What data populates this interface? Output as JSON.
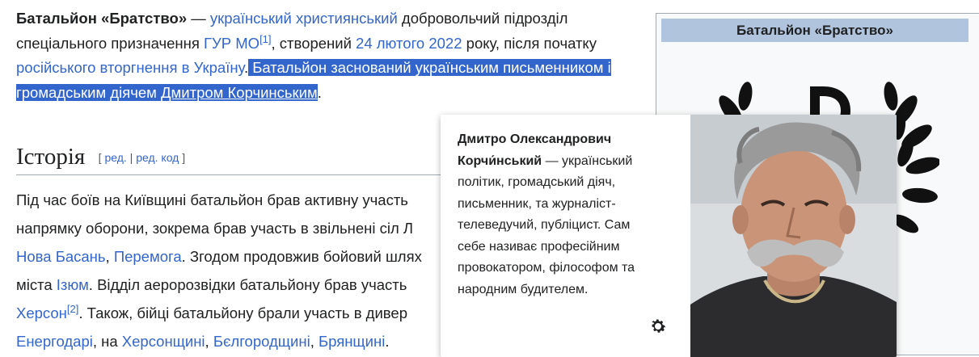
{
  "article": {
    "lead": {
      "subject": "Батальйон «Братство»",
      "dash": " — ",
      "link_christian": "український християнський",
      "t1": " добровольчий підрозділ спеціального призначення ",
      "link_gur": "ГУР МО",
      "ref1": "[1]",
      "t2": ", створений ",
      "link_date": "24 лютого 2022",
      "t3": " року, після початку ",
      "link_invasion": "російського вторгнення в Україну",
      "t4": ".",
      "highlight_text": " Батальйон заснований українським письменником і громадським діячем ",
      "link_korchynsky": "Дмитром Корчинським",
      "t5": "."
    },
    "history": {
      "heading": "Історія",
      "edit_open": "[ ",
      "edit_link": "ред.",
      "edit_sep": " | ",
      "edit_code_link": "ред. код",
      "edit_close": " ]",
      "line1": "Під час боїв на Київщині батальйон брав активну участь",
      "line2": "напрямку оборони, зокрема брав участь в звільнені сіл Л",
      "line3_link1": "Нова Басань",
      "line3_sep": ", ",
      "line3_link2": "Перемога",
      "line3_text": ". Згодом продовжив бойовий шлях",
      "line4_text": "міста ",
      "line4_link": "Ізюм",
      "line4_text2": ". Відділ аеророзвідки батальйону брав участь",
      "line5_link": "Херсон",
      "line5_ref": "[2]",
      "line5_text": ". Також, бійці батальйону брали участь в дивер",
      "line6_link1": "Енергодарі",
      "line6_text1": ", на ",
      "line6_link2": "Херсонщині",
      "line6_sep1": ", ",
      "line6_link3": "Бєлгородщині",
      "line6_sep2": ", ",
      "line6_link4": "Брянщині",
      "line6_end": "."
    }
  },
  "infobox": {
    "title": "Батальйон «Братство»"
  },
  "popup": {
    "name_bold": "Дмитро Олександрович Корчи́нський",
    "description": " — український політик, громадський діяч, письменник, та журналіст-телеведучий, публіцист. Сам себе називає професійним провокатором, філософом та народним будителем.",
    "settings_icon": "gear-icon"
  },
  "colors": {
    "link": "#3366cc",
    "selection": "#3366cc",
    "infobox_header": "#b0c4de"
  }
}
